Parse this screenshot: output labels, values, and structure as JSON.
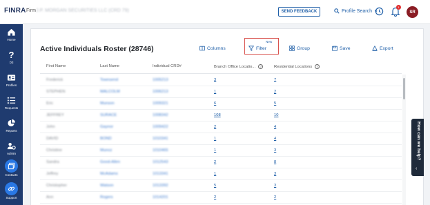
{
  "header": {
    "logo": "FINRA",
    "firm_label": "Firm",
    "firm_name": "J.P. MORGAN SECURITIES LLC (CRD 79)",
    "send_feedback": "SEND FEEDBACK",
    "profile_search": "Profile Search",
    "notification_count": "1",
    "avatar_initials": "SR"
  },
  "sidebar": {
    "items": [
      {
        "label": "Home",
        "icon": "home-icon"
      },
      {
        "label": "D3",
        "icon": "question-icon"
      },
      {
        "label": "Profiles",
        "icon": "id-card-icon"
      },
      {
        "label": "Requests",
        "icon": "list-icon"
      },
      {
        "label": "Reports",
        "icon": "pie-chart-icon"
      },
      {
        "label": "Admin",
        "icon": "users-gear-icon"
      },
      {
        "label": "Contacts",
        "icon": "window-icon"
      },
      {
        "label": "Support",
        "icon": "link-icon"
      }
    ]
  },
  "main": {
    "title": "Active Individuals Roster (28746)",
    "toolbar": {
      "columns": "Columns",
      "filter": "Filter",
      "filter_tag": "New",
      "group": "Group",
      "save": "Save",
      "export": "Export"
    },
    "table": {
      "headers": [
        "First Name",
        "Last Name",
        "Individual CRD#",
        "Branch Office Locatio...",
        "Residential Locations"
      ],
      "rows": [
        {
          "first": "Frederick",
          "last": "Townsend",
          "crd": "1005213",
          "branch": "3",
          "res": "7"
        },
        {
          "first": "STEPHEN",
          "last": "MALCOLM",
          "crd": "1006213",
          "branch": "1",
          "res": "2"
        },
        {
          "first": "Eric",
          "last": "Munson",
          "crd": "1009321",
          "branch": "6",
          "res": "5"
        },
        {
          "first": "JEFFREY",
          "last": "SURACE",
          "crd": "1008342",
          "branch": "108",
          "res": "10"
        },
        {
          "first": "John",
          "last": "Gaynor",
          "crd": "1009422",
          "branch": "2",
          "res": "4"
        },
        {
          "first": "DAVID",
          "last": "BOND",
          "crd": "1010341",
          "branch": "1",
          "res": "4"
        },
        {
          "first": "Christine",
          "last": "Munoz",
          "crd": "1010465",
          "branch": "1",
          "res": "3"
        },
        {
          "first": "Sandra",
          "last": "Good-Allen",
          "crd": "1012543",
          "branch": "2",
          "res": "8"
        },
        {
          "first": "Jeffrey",
          "last": "McAdams",
          "crd": "1013341",
          "branch": "1",
          "res": "3"
        },
        {
          "first": "Christopher",
          "last": "Watson",
          "crd": "1013392",
          "branch": "5",
          "res": "3"
        },
        {
          "first": "Ann",
          "last": "Rogers",
          "crd": "1014201",
          "branch": "2",
          "res": "2"
        }
      ]
    }
  },
  "help": {
    "label": "How can we help?"
  },
  "colors": {
    "sidebar": "#1f3b6f",
    "accent": "#1f5fa8",
    "highlight_border": "#d9534f",
    "avatar": "#8a1c24"
  }
}
